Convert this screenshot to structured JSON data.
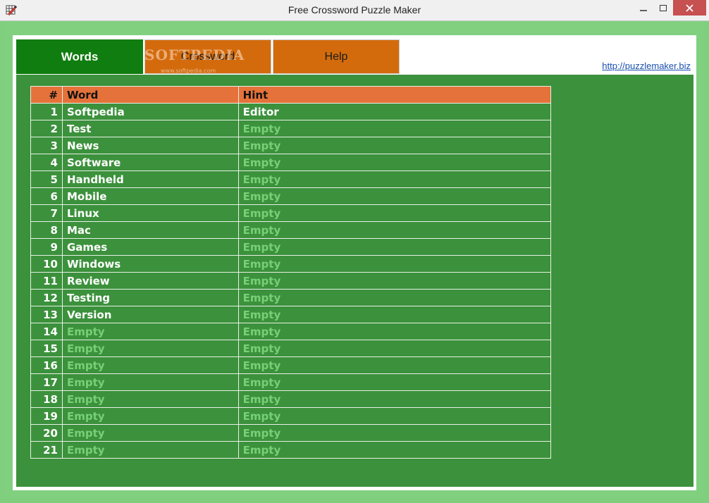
{
  "window": {
    "title": "Free Crossword Puzzle Maker"
  },
  "tabs": [
    {
      "label": "Words",
      "active": true
    },
    {
      "label": "Crossword",
      "active": false
    },
    {
      "label": "Help",
      "active": false
    }
  ],
  "watermark": {
    "text": "SOFTPEDIA",
    "sub": "www.softpedia.com"
  },
  "link": {
    "text": "http://puzzlemaker.biz"
  },
  "table": {
    "headers": {
      "num": "#",
      "word": "Word",
      "hint": "Hint"
    },
    "rows": [
      {
        "num": "1",
        "word": "Softpedia",
        "hint": "Editor"
      },
      {
        "num": "2",
        "word": "Test",
        "hint": "Empty"
      },
      {
        "num": "3",
        "word": "News",
        "hint": "Empty"
      },
      {
        "num": "4",
        "word": "Software",
        "hint": "Empty"
      },
      {
        "num": "5",
        "word": "Handheld",
        "hint": "Empty"
      },
      {
        "num": "6",
        "word": "Mobile",
        "hint": "Empty"
      },
      {
        "num": "7",
        "word": "Linux",
        "hint": "Empty"
      },
      {
        "num": "8",
        "word": "Mac",
        "hint": "Empty"
      },
      {
        "num": "9",
        "word": "Games",
        "hint": "Empty"
      },
      {
        "num": "10",
        "word": "Windows",
        "hint": "Empty"
      },
      {
        "num": "11",
        "word": "Review",
        "hint": "Empty"
      },
      {
        "num": "12",
        "word": "Testing",
        "hint": "Empty"
      },
      {
        "num": "13",
        "word": "Version",
        "hint": "Empty"
      },
      {
        "num": "14",
        "word": "Empty",
        "hint": "Empty"
      },
      {
        "num": "15",
        "word": "Empty",
        "hint": "Empty"
      },
      {
        "num": "16",
        "word": "Empty",
        "hint": "Empty"
      },
      {
        "num": "17",
        "word": "Empty",
        "hint": "Empty"
      },
      {
        "num": "18",
        "word": "Empty",
        "hint": "Empty"
      },
      {
        "num": "19",
        "word": "Empty",
        "hint": "Empty"
      },
      {
        "num": "20",
        "word": "Empty",
        "hint": "Empty"
      },
      {
        "num": "21",
        "word": "Empty",
        "hint": "Empty"
      }
    ]
  },
  "colors": {
    "panel": "#3c913c",
    "active_tab": "#0f7d0f",
    "inactive_tab": "#d36b0d",
    "header_row": "#e5723a",
    "placeholder_text": "#77d077"
  },
  "icons": {
    "app": "pencil-puzzle-icon",
    "minimize": "minimize-icon",
    "maximize": "maximize-icon",
    "close": "close-icon"
  }
}
